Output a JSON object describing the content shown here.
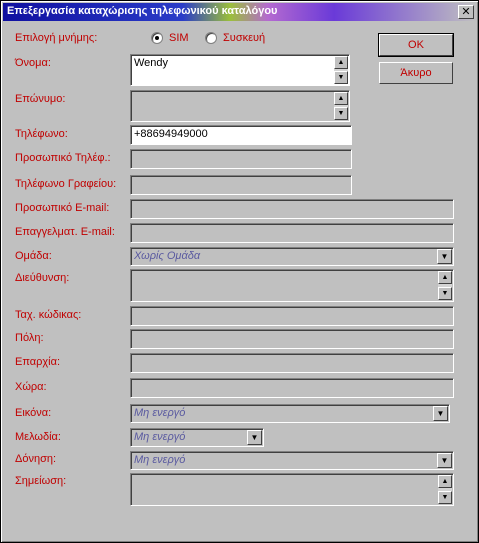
{
  "window": {
    "title": "Επεξεργασία καταχώρισης τηλεφωνικού καταλόγου",
    "close_glyph": "✕",
    "ok_label": "OK",
    "cancel_label": "Άκυρο"
  },
  "memory": {
    "label": "Επιλογή μνήμης:",
    "options": [
      "SIM",
      "Συσκευή"
    ],
    "selected": "SIM"
  },
  "fields": {
    "name": {
      "label": "Όνομα:",
      "value": "Wendy"
    },
    "surname": {
      "label": "Επώνυμο:",
      "value": ""
    },
    "phone": {
      "label": "Τηλέφωνο:",
      "value": "+88694949000"
    },
    "personal_phone": {
      "label": "Προσωπικό Τηλέφ.:",
      "value": ""
    },
    "office_phone": {
      "label": "Τηλέφωνο Γραφείου:",
      "value": ""
    },
    "personal_email": {
      "label": "Προσωπικό E-mail:",
      "value": ""
    },
    "work_email": {
      "label": "Επαγγελματ. E-mail:",
      "value": ""
    },
    "group": {
      "label": "Ομάδα:",
      "value": "Χωρίς Ομάδα"
    },
    "address": {
      "label": "Διεύθυνση:",
      "value": ""
    },
    "postal_code": {
      "label": "Ταχ. κώδικας:",
      "value": ""
    },
    "city": {
      "label": "Πόλη:",
      "value": ""
    },
    "region": {
      "label": "Επαρχία:",
      "value": ""
    },
    "country": {
      "label": "Χώρα:",
      "value": ""
    },
    "image": {
      "label": "Εικόνα:",
      "value": "Μη ενεργό"
    },
    "melody": {
      "label": "Μελωδία:",
      "value": "Μη ενεργό"
    },
    "vibration": {
      "label": "Δόνηση:",
      "value": "Μη ενεργό"
    },
    "note": {
      "label": "Σημείωση:",
      "value": ""
    }
  },
  "icons": {
    "scroll_up": "▲",
    "scroll_down": "▼",
    "dropdown": "▼"
  }
}
